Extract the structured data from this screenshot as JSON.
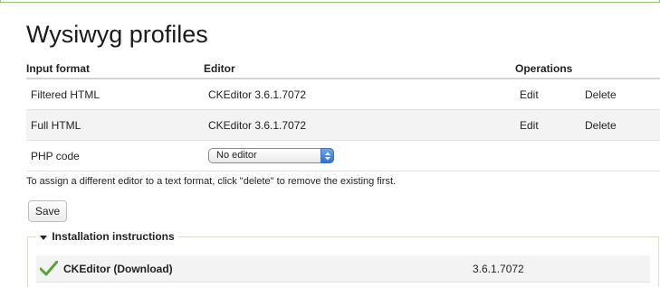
{
  "page": {
    "title": "Wysiwyg profiles"
  },
  "table": {
    "headers": {
      "input_format": "Input format",
      "editor": "Editor",
      "operations": "Operations"
    },
    "rows": [
      {
        "format": "Filtered HTML",
        "editor": "CKEditor 3.6.1.7072",
        "edit": "Edit",
        "delete": "Delete"
      },
      {
        "format": "Full HTML",
        "editor": "CKEditor 3.6.1.7072",
        "edit": "Edit",
        "delete": "Delete"
      }
    ],
    "php_row": {
      "format": "PHP code",
      "select_value": "No editor"
    }
  },
  "help_text": "To assign a different editor to a text format, click \"delete\" to remove the existing first.",
  "save_label": "Save",
  "installation": {
    "legend": "Installation instructions",
    "libraries": [
      {
        "name": "CKEditor (Download)",
        "version": "3.6.1.7072",
        "status_icon": "check-icon"
      }
    ]
  },
  "colors": {
    "frame_green": "#8fc67a",
    "check_green": "#5aa531",
    "select_blue": "#2f6fd6"
  }
}
